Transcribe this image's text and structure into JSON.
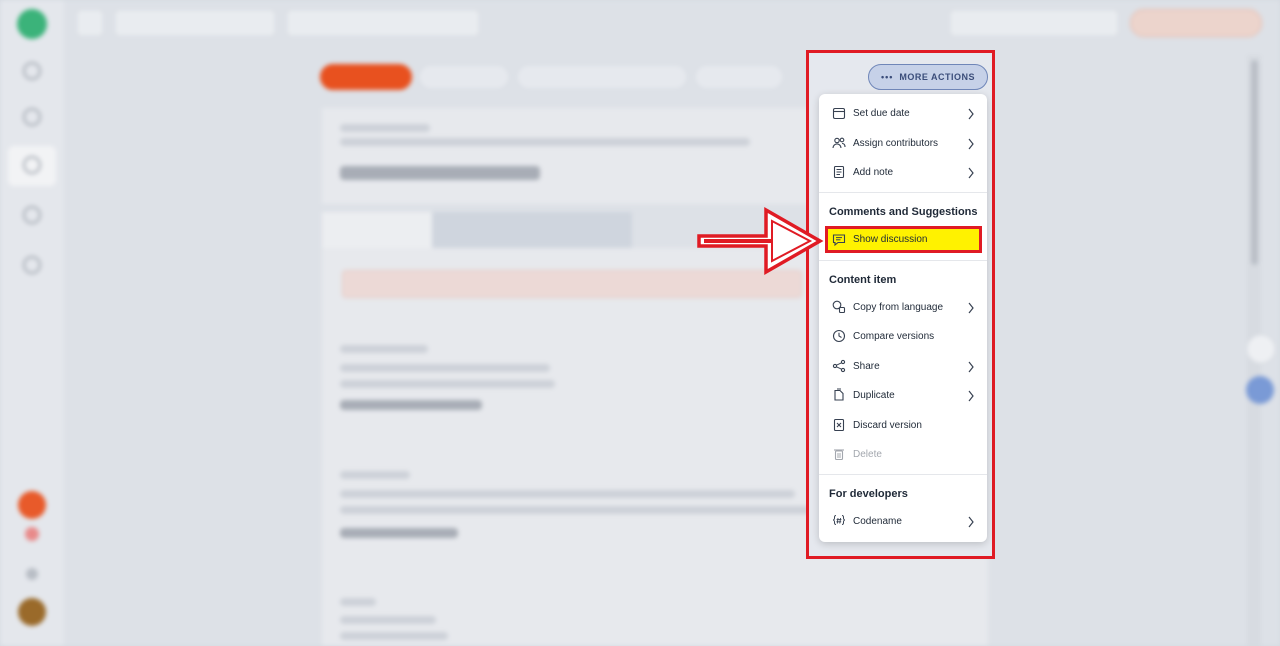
{
  "more_actions": {
    "label": "MORE ACTIONS"
  },
  "menu": {
    "group1": [
      {
        "label": "Set due date",
        "icon": "calendar-icon",
        "submenu": true
      },
      {
        "label": "Assign contributors",
        "icon": "users-icon",
        "submenu": true
      },
      {
        "label": "Add note",
        "icon": "note-icon",
        "submenu": true
      }
    ],
    "comments_heading": "Comments and Suggestions",
    "show_discussion": {
      "label": "Show discussion",
      "icon": "discussion-icon",
      "highlighted": true
    },
    "content_heading": "Content item",
    "group2": [
      {
        "label": "Copy from language",
        "icon": "language-icon",
        "submenu": true
      },
      {
        "label": "Compare versions",
        "icon": "clock-icon",
        "submenu": false
      },
      {
        "label": "Share",
        "icon": "share-icon",
        "submenu": true
      },
      {
        "label": "Duplicate",
        "icon": "duplicate-icon",
        "submenu": true
      },
      {
        "label": "Discard version",
        "icon": "discard-icon",
        "submenu": false
      },
      {
        "label": "Delete",
        "icon": "trash-icon",
        "submenu": false,
        "disabled": true
      }
    ],
    "developers_heading": "For developers",
    "codename": {
      "label": "Codename",
      "icon": "hash-braces-icon",
      "submenu": true
    }
  },
  "colors": {
    "highlight_border": "#e01b24",
    "highlight_fill": "#fff200",
    "primary_orange": "#e8511f",
    "more_actions_bg": "#c6d1e8"
  }
}
